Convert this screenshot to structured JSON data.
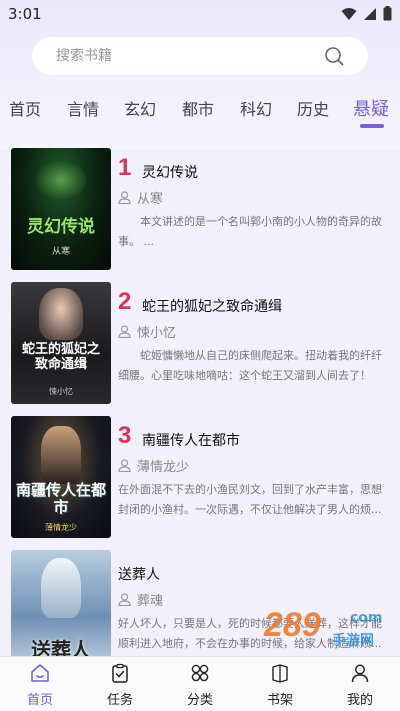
{
  "status": {
    "time": "3:01"
  },
  "search": {
    "placeholder": "搜索书籍"
  },
  "tabs": [
    {
      "label": "首页",
      "active": false
    },
    {
      "label": "言情",
      "active": false
    },
    {
      "label": "玄幻",
      "active": false
    },
    {
      "label": "都市",
      "active": false
    },
    {
      "label": "科幻",
      "active": false
    },
    {
      "label": "历史",
      "active": false
    },
    {
      "label": "悬疑",
      "active": true
    }
  ],
  "books": [
    {
      "rank": "1",
      "title": "灵幻传说",
      "author": "从寒",
      "description": "本文讲述的是一个名叫郭小南的小人物的奇异的故事。 ...",
      "cover_title": "灵幻传说",
      "cover_author": "从寒"
    },
    {
      "rank": "2",
      "title": "蛇王的狐妃之致命通缉",
      "author": "悚小忆",
      "description": "蛇姬慵懒地从自己的床侧爬起来。扭动着我的纤纤细腰。心里吃味地嘀咕：这个蛇王又溜到人间去了！到...",
      "cover_title": "蛇王的狐妃之致命通缉",
      "cover_author": "悚小忆"
    },
    {
      "rank": "3",
      "title": "南疆传人在都市",
      "author": "薄情龙少",
      "description": "在外面混不下去的小渔民刘文，回到了水产丰富，思想封闭的小渔村。一次际遇，不仅让他解决了男人的烦...",
      "cover_title": "南疆传人在都市",
      "cover_author": "薄情龙少"
    },
    {
      "rank": "",
      "title": "送葬人",
      "author": "葬魂",
      "description": "好人坏人，只要是人，死的时候都要人送葬，这样才能顺利进入地府，不会在办事的时候，给家人制造麻烦...",
      "cover_title": "送葬人",
      "cover_author": ""
    }
  ],
  "bottom_nav": [
    {
      "label": "首页",
      "icon": "home-icon",
      "active": true
    },
    {
      "label": "任务",
      "icon": "task-icon",
      "active": false
    },
    {
      "label": "分类",
      "icon": "category-icon",
      "active": false
    },
    {
      "label": "书架",
      "icon": "bookshelf-icon",
      "active": false
    },
    {
      "label": "我的",
      "icon": "profile-icon",
      "active": false
    }
  ],
  "watermark": {
    "text": "289",
    "subtext": "手游网",
    "domain": "com"
  },
  "colors": {
    "accent": "#7b5fe0",
    "rank": "#e0315b",
    "background": "#f2f1fb"
  }
}
